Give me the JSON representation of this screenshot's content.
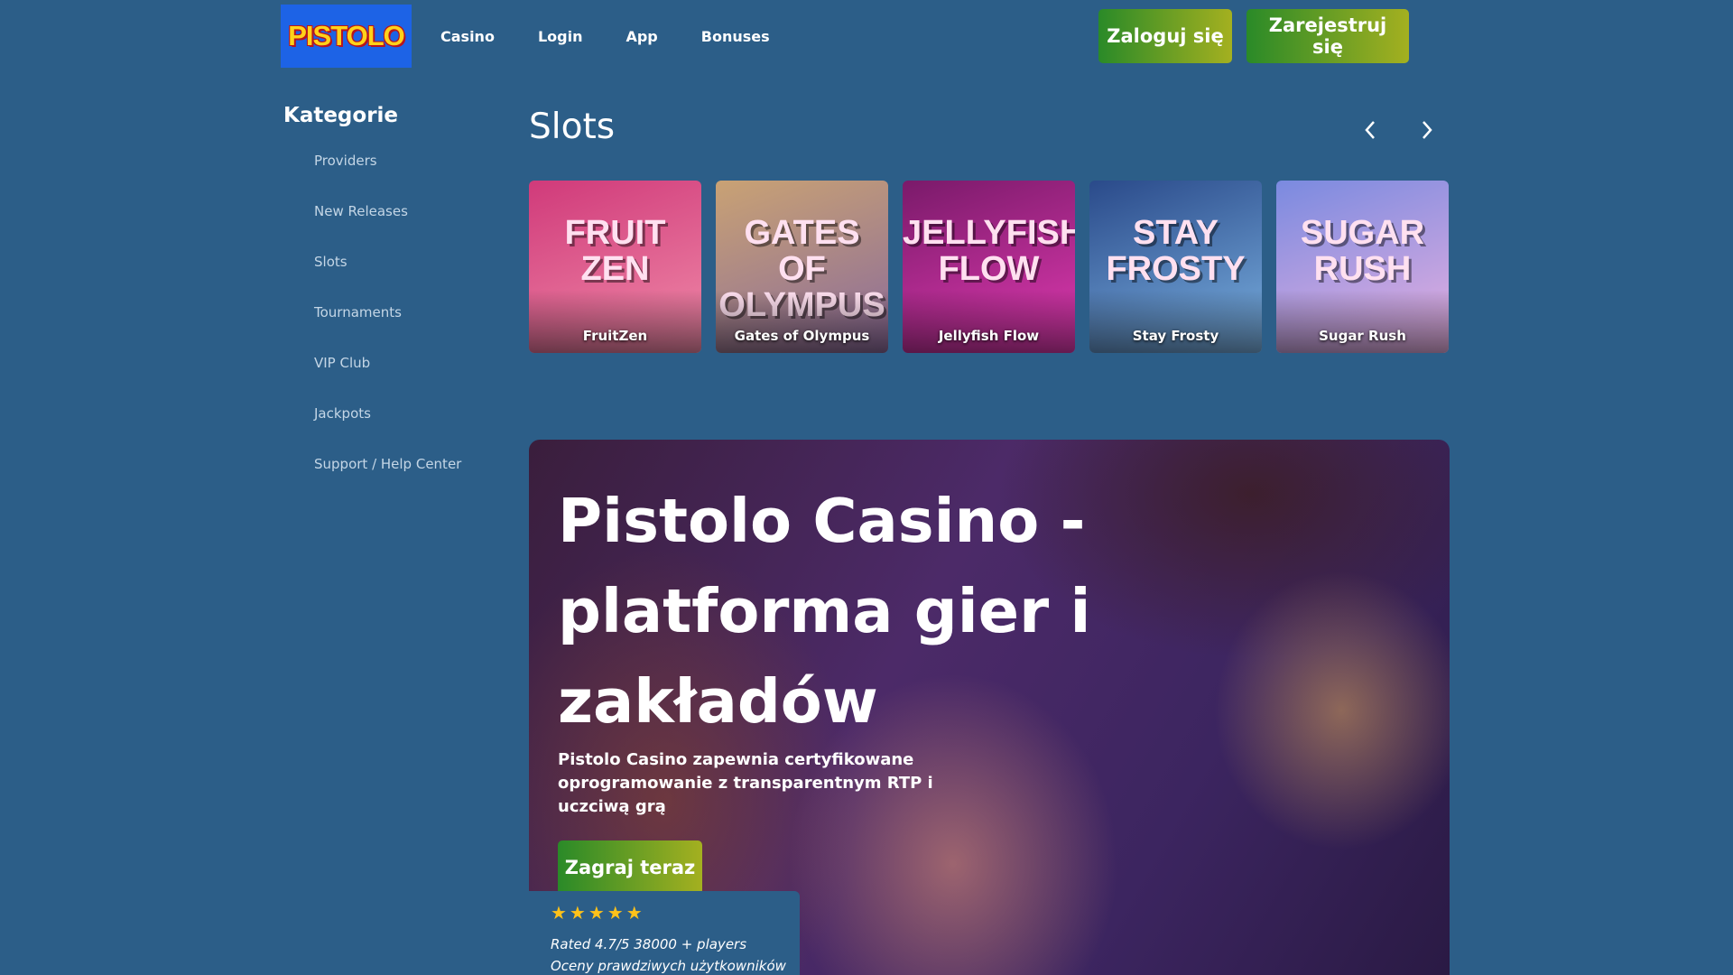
{
  "header": {
    "logo_text": "PISTOLO",
    "nav": [
      "Casino",
      "Login",
      "App",
      "Bonuses"
    ],
    "login_label": "Zaloguj się",
    "register_label": "Zarejestruj się"
  },
  "sidebar": {
    "title": "Kategorie",
    "items": [
      "Providers",
      "New Releases",
      "Slots",
      "Tournaments",
      "VIP Club",
      "Jackpots",
      "Support / Help Center"
    ]
  },
  "slots": {
    "title": "Slots",
    "prev_icon": "chevron-left-icon",
    "next_icon": "chevron-right-icon",
    "games": [
      {
        "name": "FruitZen",
        "art": "FRUIT ZEN",
        "color1": "#d03a7a",
        "color2": "#f08aa8"
      },
      {
        "name": "Gates of Olympus",
        "art": "GATES OF OLYMPUS",
        "color1": "#c9a274",
        "color2": "#8a6a9a"
      },
      {
        "name": "Jellyfish Flow",
        "art": "JELLYFISH FLOW",
        "color1": "#7a1a6a",
        "color2": "#e03ab0"
      },
      {
        "name": "Stay Frosty",
        "art": "STAY FROSTY",
        "color1": "#2a4a8a",
        "color2": "#7ab0e0"
      },
      {
        "name": "Sugar Rush",
        "art": "SUGAR RUSH",
        "color1": "#7a8ae0",
        "color2": "#e8b0e0"
      }
    ]
  },
  "hero": {
    "title": "Pistolo Casino - platforma gier i zakładów",
    "subtitle": "Pistolo Casino zapewnia certyfikowane oprogramowanie z transparentnym RTP i uczciwą grą",
    "cta": "Zagraj teraz"
  },
  "rating": {
    "stars": "★★★★★",
    "score_line": "Rated  4.7/5  38000 + players",
    "note": "Oceny prawdziwych użytkowników"
  },
  "colors": {
    "background": "#2c5e88",
    "cta_gradient_start": "#2a8a28",
    "cta_gradient_end": "#a4b020",
    "logo_bg": "#1d63e6"
  }
}
